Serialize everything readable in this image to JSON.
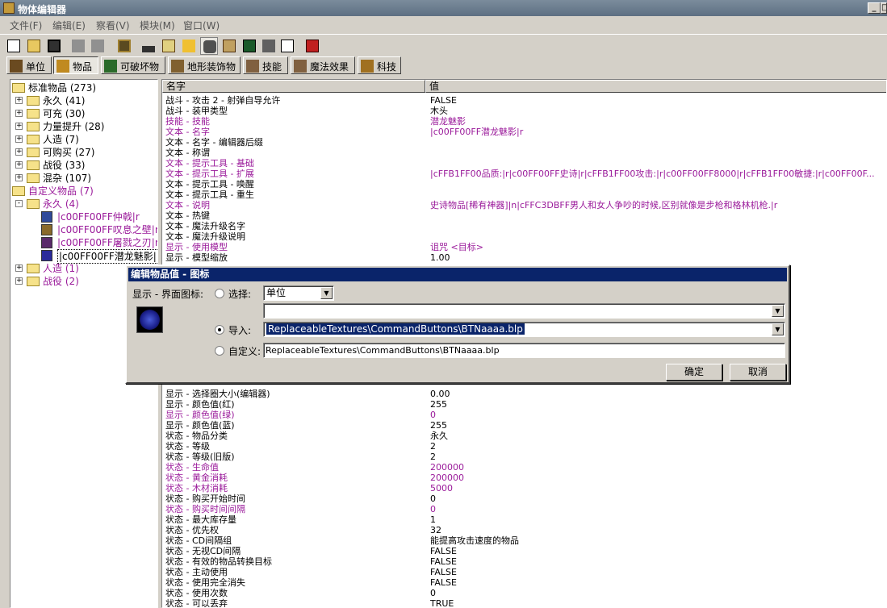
{
  "window": {
    "title": "物体编辑器",
    "min_label": "_",
    "max_label": "□"
  },
  "menu": [
    "文件(F)",
    "编辑(E)",
    "察看(V)",
    "模块(M)",
    "窗口(W)"
  ],
  "tabs": [
    {
      "label": "单位",
      "icon": "unit-icon",
      "active": false
    },
    {
      "label": "物品",
      "icon": "item-icon",
      "active": true
    },
    {
      "label": "可破坏物",
      "icon": "destructible-icon",
      "active": false
    },
    {
      "label": "地形装饰物",
      "icon": "doodad-icon",
      "active": false
    },
    {
      "label": "技能",
      "icon": "ability-icon",
      "active": false
    },
    {
      "label": "魔法效果",
      "icon": "buff-icon",
      "active": false
    },
    {
      "label": "科技",
      "icon": "upgrade-icon",
      "active": false
    }
  ],
  "tree": [
    {
      "label": "标准物品 (273)",
      "level": 0,
      "expander": "",
      "folder": true,
      "open": true,
      "purple": false
    },
    {
      "label": "永久 (41)",
      "level": 1,
      "expander": "+",
      "folder": true,
      "purple": false
    },
    {
      "label": "可充 (30)",
      "level": 1,
      "expander": "+",
      "folder": true,
      "purple": false
    },
    {
      "label": "力量提升 (28)",
      "level": 1,
      "expander": "+",
      "folder": true,
      "purple": false
    },
    {
      "label": "人造 (7)",
      "level": 1,
      "expander": "+",
      "folder": true,
      "purple": false
    },
    {
      "label": "可购买 (27)",
      "level": 1,
      "expander": "+",
      "folder": true,
      "purple": false
    },
    {
      "label": "战役 (33)",
      "level": 1,
      "expander": "+",
      "folder": true,
      "purple": false
    },
    {
      "label": "混杂 (107)",
      "level": 1,
      "expander": "+",
      "folder": true,
      "purple": false
    },
    {
      "label": "自定义物品 (7)",
      "level": 0,
      "expander": "",
      "folder": true,
      "open": true,
      "purple": true
    },
    {
      "label": "永久 (4)",
      "level": 1,
      "expander": "-",
      "folder": true,
      "purple": true
    },
    {
      "label": "|c00FF00FF仲戟|r",
      "level": 2,
      "expander": "",
      "folder": false,
      "purple": true
    },
    {
      "label": "|c00FF00FF叹息之壁|r",
      "level": 2,
      "expander": "",
      "folder": false,
      "purple": true
    },
    {
      "label": "|c00FF00FF屠戮之刃|r",
      "level": 2,
      "expander": "",
      "folder": false,
      "purple": true
    },
    {
      "label": "|c00FF00FF潜龙魅影|r",
      "level": 2,
      "expander": "",
      "folder": false,
      "purple": false,
      "selected": true
    },
    {
      "label": "人造 (1)",
      "level": 1,
      "expander": "+",
      "folder": true,
      "purple": true
    },
    {
      "label": "战役 (2)",
      "level": 1,
      "expander": "+",
      "folder": true,
      "purple": true
    }
  ],
  "grid": {
    "col_name": "名字",
    "col_value": "值",
    "rows_top": [
      {
        "name": "战斗 - 攻击 2 - 射弹自导允许",
        "value": "FALSE",
        "mod": false
      },
      {
        "name": "战斗 - 装甲类型",
        "value": "木头",
        "mod": false
      },
      {
        "name": "技能 - 技能",
        "value": "潜龙魅影",
        "mod": true
      },
      {
        "name": "文本 - 名字",
        "value": "|c00FF00FF潜龙魅影|r",
        "mod": true
      },
      {
        "name": "文本 - 名字 - 编辑器后缀",
        "value": "",
        "mod": false
      },
      {
        "name": "文本 - 称谓",
        "value": "",
        "mod": false
      },
      {
        "name": "文本 - 提示工具 - 基础",
        "value": "",
        "mod": true
      },
      {
        "name": "文本 - 提示工具 - 扩展",
        "value": "|cFFB1FF00品质:|r|c00FF00FF史诗|r|cFFB1FF00攻击:|r|c00FF00FF8000|r|cFFB1FF00敏捷:|r|c00FF00F...",
        "mod": true
      },
      {
        "name": "文本 - 提示工具 - 唤醒",
        "value": "",
        "mod": false
      },
      {
        "name": "文本 - 提示工具 - 重生",
        "value": "",
        "mod": false
      },
      {
        "name": "文本 - 说明",
        "value": "史诗物品[稀有神器]|n|cFFC3DBFF男人和女人争吵的时候,区别就像是步枪和格林机枪.|r",
        "mod": true
      },
      {
        "name": "文本 - 热键",
        "value": "",
        "mod": false
      },
      {
        "name": "文本 - 魔法升级名字",
        "value": "",
        "mod": false
      },
      {
        "name": "文本 - 魔法升级说明",
        "value": "",
        "mod": false
      },
      {
        "name": "显示 - 使用模型",
        "value": "诅咒 <目标>",
        "mod": true
      },
      {
        "name": "显示 - 模型缩放",
        "value": "1.00",
        "mod": false
      }
    ],
    "rows_bottom": [
      {
        "name": "显示 - 选择圈大小(编辑器)",
        "value": "0.00",
        "mod": false
      },
      {
        "name": "显示 - 颜色值(红)",
        "value": "255",
        "mod": false
      },
      {
        "name": "显示 - 颜色值(绿)",
        "value": "0",
        "mod": true
      },
      {
        "name": "显示 - 颜色值(蓝)",
        "value": "255",
        "mod": false
      },
      {
        "name": "状态 - 物品分类",
        "value": "永久",
        "mod": false
      },
      {
        "name": "状态 - 等级",
        "value": "2",
        "mod": false
      },
      {
        "name": "状态 - 等级(旧版)",
        "value": "2",
        "mod": false
      },
      {
        "name": "状态 - 生命值",
        "value": "200000",
        "mod": true
      },
      {
        "name": "状态 - 黄金消耗",
        "value": "200000",
        "mod": true
      },
      {
        "name": "状态 - 木材消耗",
        "value": "5000",
        "mod": true
      },
      {
        "name": "状态 - 购买开始时间",
        "value": "0",
        "mod": false
      },
      {
        "name": "状态 - 购买时间间隔",
        "value": "0",
        "mod": true
      },
      {
        "name": "状态 - 最大库存量",
        "value": "1",
        "mod": false
      },
      {
        "name": "状态 - 优先权",
        "value": "32",
        "mod": false
      },
      {
        "name": "状态 - CD间隔组",
        "value": "能提高攻击速度的物品",
        "mod": false
      },
      {
        "name": "状态 - 无视CD间隔",
        "value": "FALSE",
        "mod": false
      },
      {
        "name": "状态 - 有效的物品转换目标",
        "value": "FALSE",
        "mod": false
      },
      {
        "name": "状态 - 主动使用",
        "value": "FALSE",
        "mod": false
      },
      {
        "name": "状态 - 使用完全消失",
        "value": "FALSE",
        "mod": false
      },
      {
        "name": "状态 - 使用次数",
        "value": "0",
        "mod": false
      },
      {
        "name": "状态 - 可以丢弃",
        "value": "TRUE",
        "mod": false
      }
    ]
  },
  "dialog": {
    "title": "编辑物品值 - 图标",
    "field_label": "显示 - 界面图标:",
    "opt_select": "选择:",
    "select_value": "单位",
    "select_list_value": "",
    "opt_import": "导入:",
    "import_value": "ReplaceableTextures\\CommandButtons\\BTNaaaa.blp",
    "opt_custom": "自定义:",
    "custom_value": "ReplaceableTextures\\CommandButtons\\BTNaaaa.blp",
    "ok": "确定",
    "cancel": "取消"
  }
}
